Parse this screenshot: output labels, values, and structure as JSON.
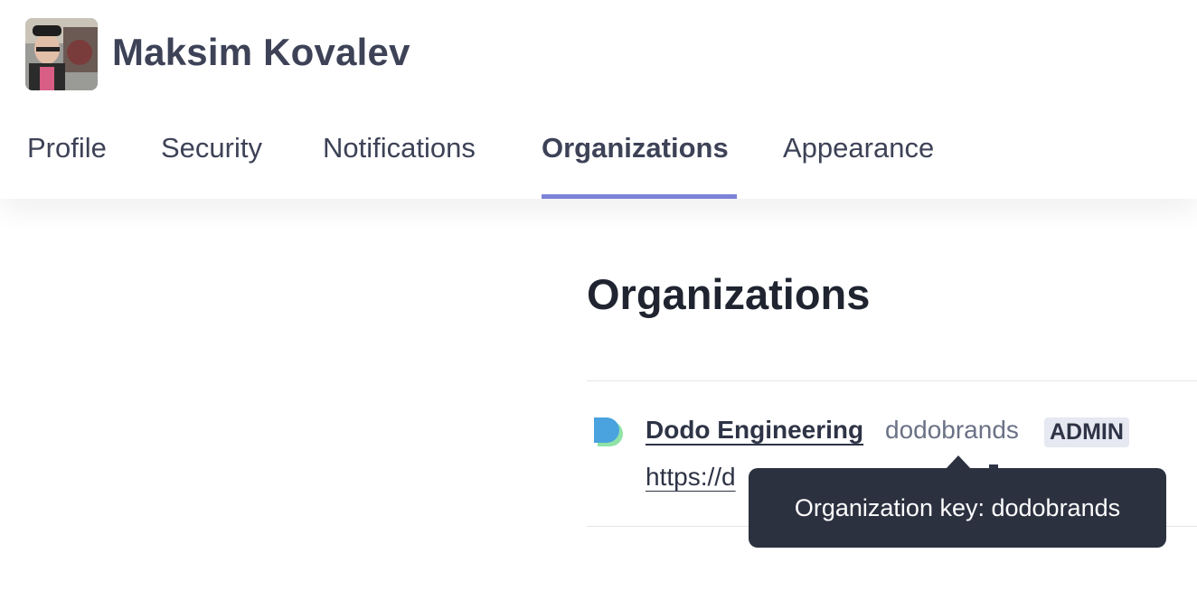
{
  "user": {
    "name": "Maksim Kovalev",
    "avatar_alt": "avatar"
  },
  "tabs": [
    {
      "label": "Profile"
    },
    {
      "label": "Security"
    },
    {
      "label": "Notifications"
    },
    {
      "label": "Organizations",
      "active": true
    },
    {
      "label": "Appearance"
    }
  ],
  "main": {
    "title": "Organizations",
    "organizations": [
      {
        "name": "Dodo Engineering",
        "key": "dodobrands",
        "role": "ADMIN",
        "url_visible": "https://d"
      }
    ]
  },
  "tooltip": {
    "text": "Organization key: dodobrands"
  },
  "colors": {
    "accent_underline": "#7b83d8",
    "tooltip_bg": "#2c3140",
    "badge_bg": "#e6e8f2"
  }
}
